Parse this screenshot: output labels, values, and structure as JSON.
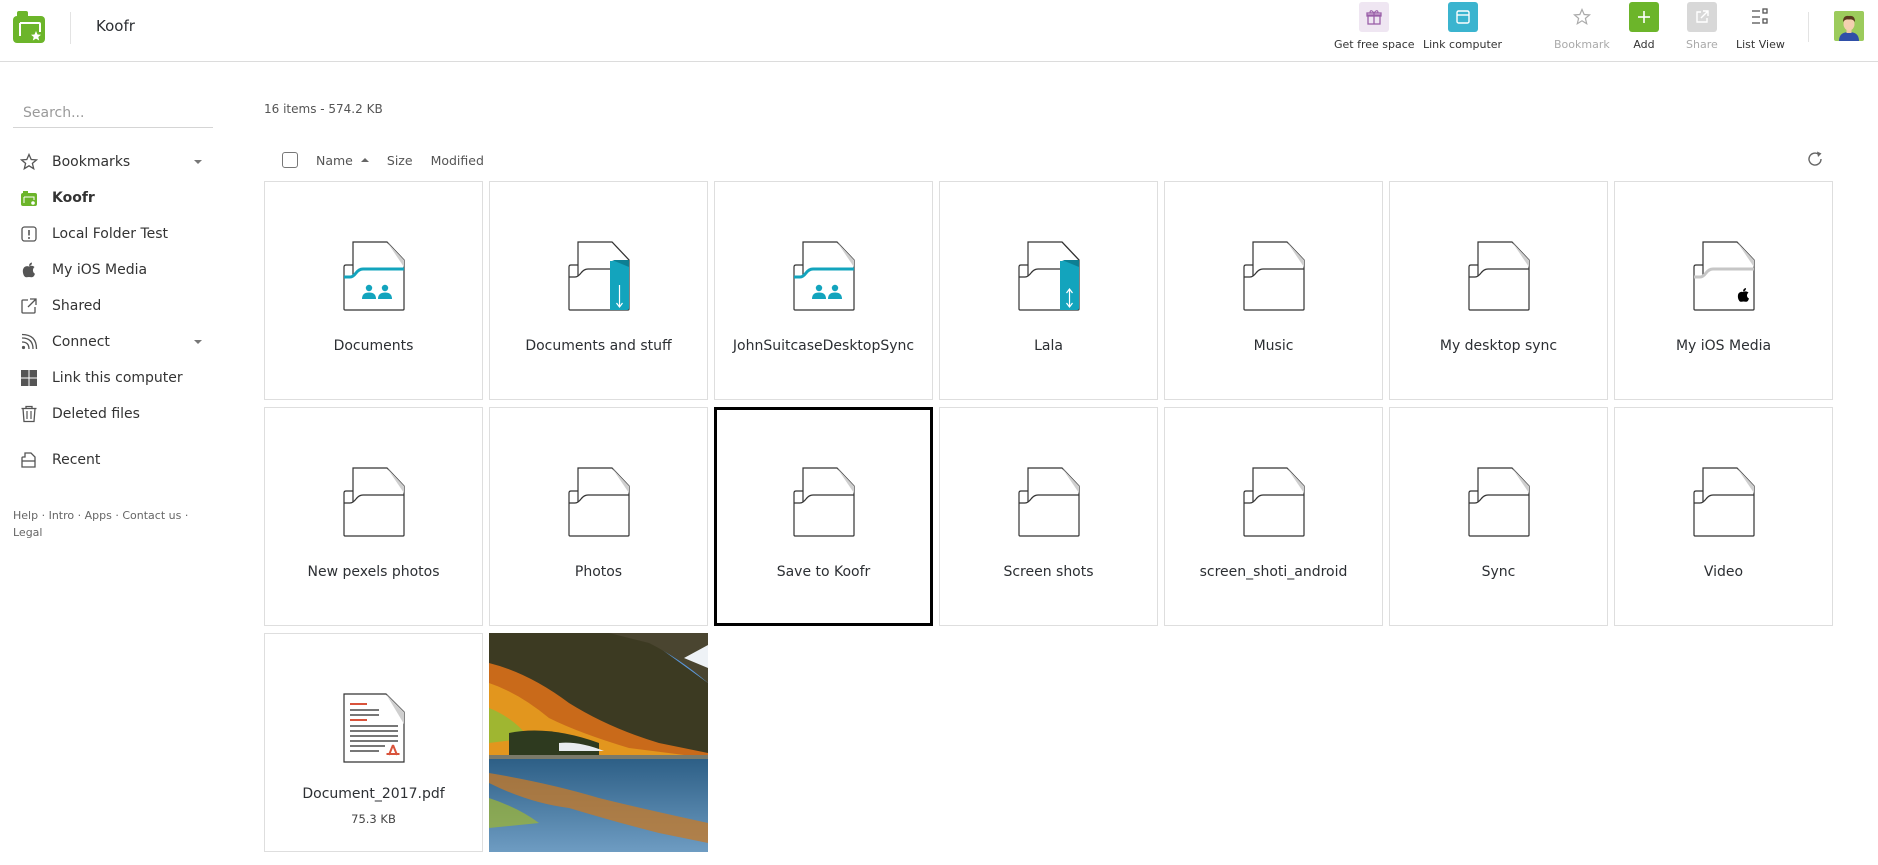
{
  "topbar": {
    "title": "Koofr",
    "buttons": [
      {
        "id": "get-free-space",
        "label": "Get free space",
        "icon": "gift-icon",
        "color": "#efe6f2",
        "disabled": false
      },
      {
        "id": "link-computer",
        "label": "Link computer",
        "icon": "window-icon",
        "color": "#3bb4cf",
        "disabled": false
      },
      {
        "id": "bookmark",
        "label": "Bookmark",
        "icon": "star-icon",
        "disabled": true
      },
      {
        "id": "add",
        "label": "Add",
        "icon": "plus-icon",
        "color": "#6cb52a",
        "disabled": false
      },
      {
        "id": "share",
        "label": "Share",
        "icon": "share-icon",
        "color": "#d8d8d8",
        "disabled": true
      },
      {
        "id": "list-view",
        "label": "List View",
        "icon": "list-view-icon",
        "disabled": false
      }
    ]
  },
  "sidebar": {
    "search_placeholder": "Search...",
    "items": [
      {
        "label": "Bookmarks",
        "icon": "star-icon",
        "expandable": true
      },
      {
        "label": "Koofr",
        "icon": "koofr-folder-icon",
        "active": true
      },
      {
        "label": "Local Folder Test",
        "icon": "exclamation-box-icon"
      },
      {
        "label": "My iOS Media",
        "icon": "apple-icon"
      },
      {
        "label": "Shared",
        "icon": "share-icon"
      },
      {
        "label": "Connect",
        "icon": "rss-icon",
        "expandable": true
      },
      {
        "label": "Link this computer",
        "icon": "windows-icon"
      },
      {
        "label": "Deleted files",
        "icon": "trash-icon"
      },
      {
        "label": "Recent",
        "icon": "recent-icon"
      }
    ],
    "footer_links": [
      "Help",
      "Intro",
      "Apps",
      "Contact us",
      "Legal"
    ],
    "footer_separator": " · "
  },
  "main": {
    "summary": "16 items - 574.2 KB",
    "columns": {
      "name": "Name",
      "size": "Size",
      "modified": "Modified"
    },
    "sort": {
      "column": "name",
      "direction": "ascending"
    },
    "items": [
      {
        "name": "Documents",
        "type": "folder-shared"
      },
      {
        "name": "Documents and stuff",
        "type": "folder-sync-down"
      },
      {
        "name": "JohnSuitcaseDesktopSync",
        "type": "folder-shared"
      },
      {
        "name": "Lala",
        "type": "folder-sync-both"
      },
      {
        "name": "Music",
        "type": "folder"
      },
      {
        "name": "My desktop sync",
        "type": "folder"
      },
      {
        "name": "My iOS Media",
        "type": "folder-ios"
      },
      {
        "name": "New pexels photos",
        "type": "folder"
      },
      {
        "name": "Photos",
        "type": "folder"
      },
      {
        "name": "Save to Koofr",
        "type": "folder",
        "selected": true
      },
      {
        "name": "Screen shots",
        "type": "folder"
      },
      {
        "name": "screen_shoti_android",
        "type": "folder"
      },
      {
        "name": "Sync",
        "type": "folder"
      },
      {
        "name": "Video",
        "type": "folder"
      },
      {
        "name": "Document_2017.pdf",
        "type": "pdf",
        "size": "75.3 KB"
      },
      {
        "name": "",
        "type": "photo",
        "description": "mountain lake autumn landscape"
      }
    ]
  },
  "colors": {
    "brand_green": "#6cb52a",
    "accent_teal": "#13a4bd",
    "pdf_red": "#d9533b"
  }
}
